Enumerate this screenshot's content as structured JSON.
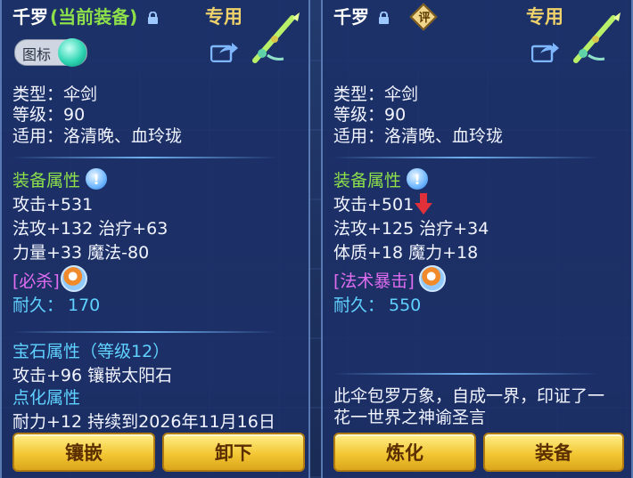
{
  "left": {
    "name": "千罗",
    "name_suffix": "(当前装备)",
    "badge": "专用",
    "icon_toggle_label": "图标",
    "type": "类型：伞剑",
    "level": "等级：90",
    "usable": "适用：洛清晚、血玲珑",
    "attr_title": "装备属性",
    "attack": "攻击+531",
    "line2": "法攻+132 治疗+63",
    "line3": "力量+33 魔法-80",
    "skill": "[必杀]",
    "durability_label": "耐久：",
    "durability_value": "170",
    "gem_title": "宝石属性（等级12）",
    "gem_line": "攻击+96 镶嵌太阳石",
    "spirit_title": "点化属性",
    "spirit_line": "耐力+12 持续到2026年11月16日",
    "btn_embed": "镶嵌",
    "btn_unequip": "卸下"
  },
  "right": {
    "name": "千罗",
    "review_badge": "评",
    "badge": "专用",
    "type": "类型：伞剑",
    "level": "等级：90",
    "usable": "适用：洛清晚、血玲珑",
    "attr_title": "装备属性",
    "attack": "攻击+501",
    "line2": "法攻+125 治疗+34",
    "line3": "体质+18 魔力+18",
    "skill": "[法术暴击]",
    "durability_label": "耐久：",
    "durability_value": "550",
    "desc_line1": "此伞包罗万象，自成一界，印证了一",
    "desc_line2": "花一世界之神谕圣言",
    "btn_refine": "炼化",
    "btn_equip": "装备"
  },
  "colors": {
    "attr_title": "#8ee04a",
    "durability": "#5fd2ff",
    "skill": "#e06cf0",
    "badge": "#f0d26a",
    "button": "#f3c734"
  },
  "icons": [
    "lock-icon",
    "share-icon",
    "weapon-icon",
    "info-icon",
    "skill-icon",
    "down-arrow-icon",
    "toggle-icon"
  ]
}
